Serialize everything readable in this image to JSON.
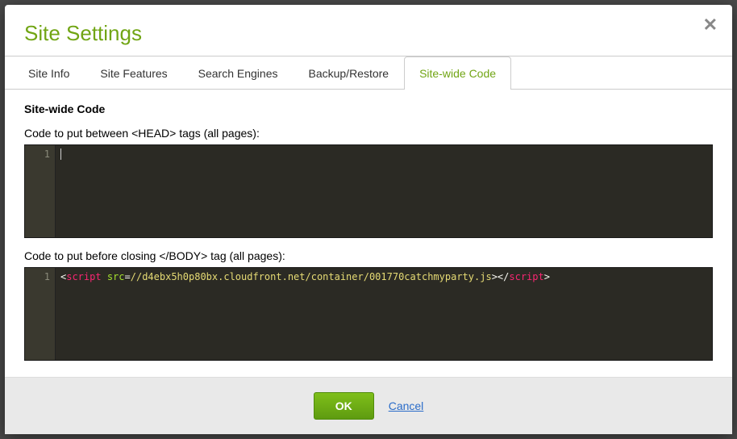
{
  "modal": {
    "title": "Site Settings",
    "close_glyph": "✕"
  },
  "tabs": {
    "items": [
      {
        "label": "Site Info",
        "active": false
      },
      {
        "label": "Site Features",
        "active": false
      },
      {
        "label": "Search Engines",
        "active": false
      },
      {
        "label": "Backup/Restore",
        "active": false
      },
      {
        "label": "Site-wide Code",
        "active": true
      }
    ]
  },
  "content": {
    "section_title": "Site-wide Code",
    "head_label": "Code to put between <HEAD> tags (all pages):",
    "head_editor": {
      "line_numbers": [
        "1"
      ],
      "code": ""
    },
    "body_label": "Code to put before closing </BODY> tag (all pages):",
    "body_editor": {
      "line_numbers": [
        "1"
      ],
      "code_plain": "<script src=//d4ebx5h0p80bx.cloudfront.net/container/001770catchmyparty.js></script>",
      "tokens": {
        "open": "<",
        "tag_open": "script",
        "space": " ",
        "attr": "src",
        "eq": "=",
        "val": "//d4ebx5h0p80bx.cloudfront.net/container/001770catchmyparty.js",
        "close1": ">",
        "open2": "</",
        "tag_close": "script",
        "close2": ">"
      }
    }
  },
  "footer": {
    "ok_label": "OK",
    "cancel_label": "Cancel"
  }
}
